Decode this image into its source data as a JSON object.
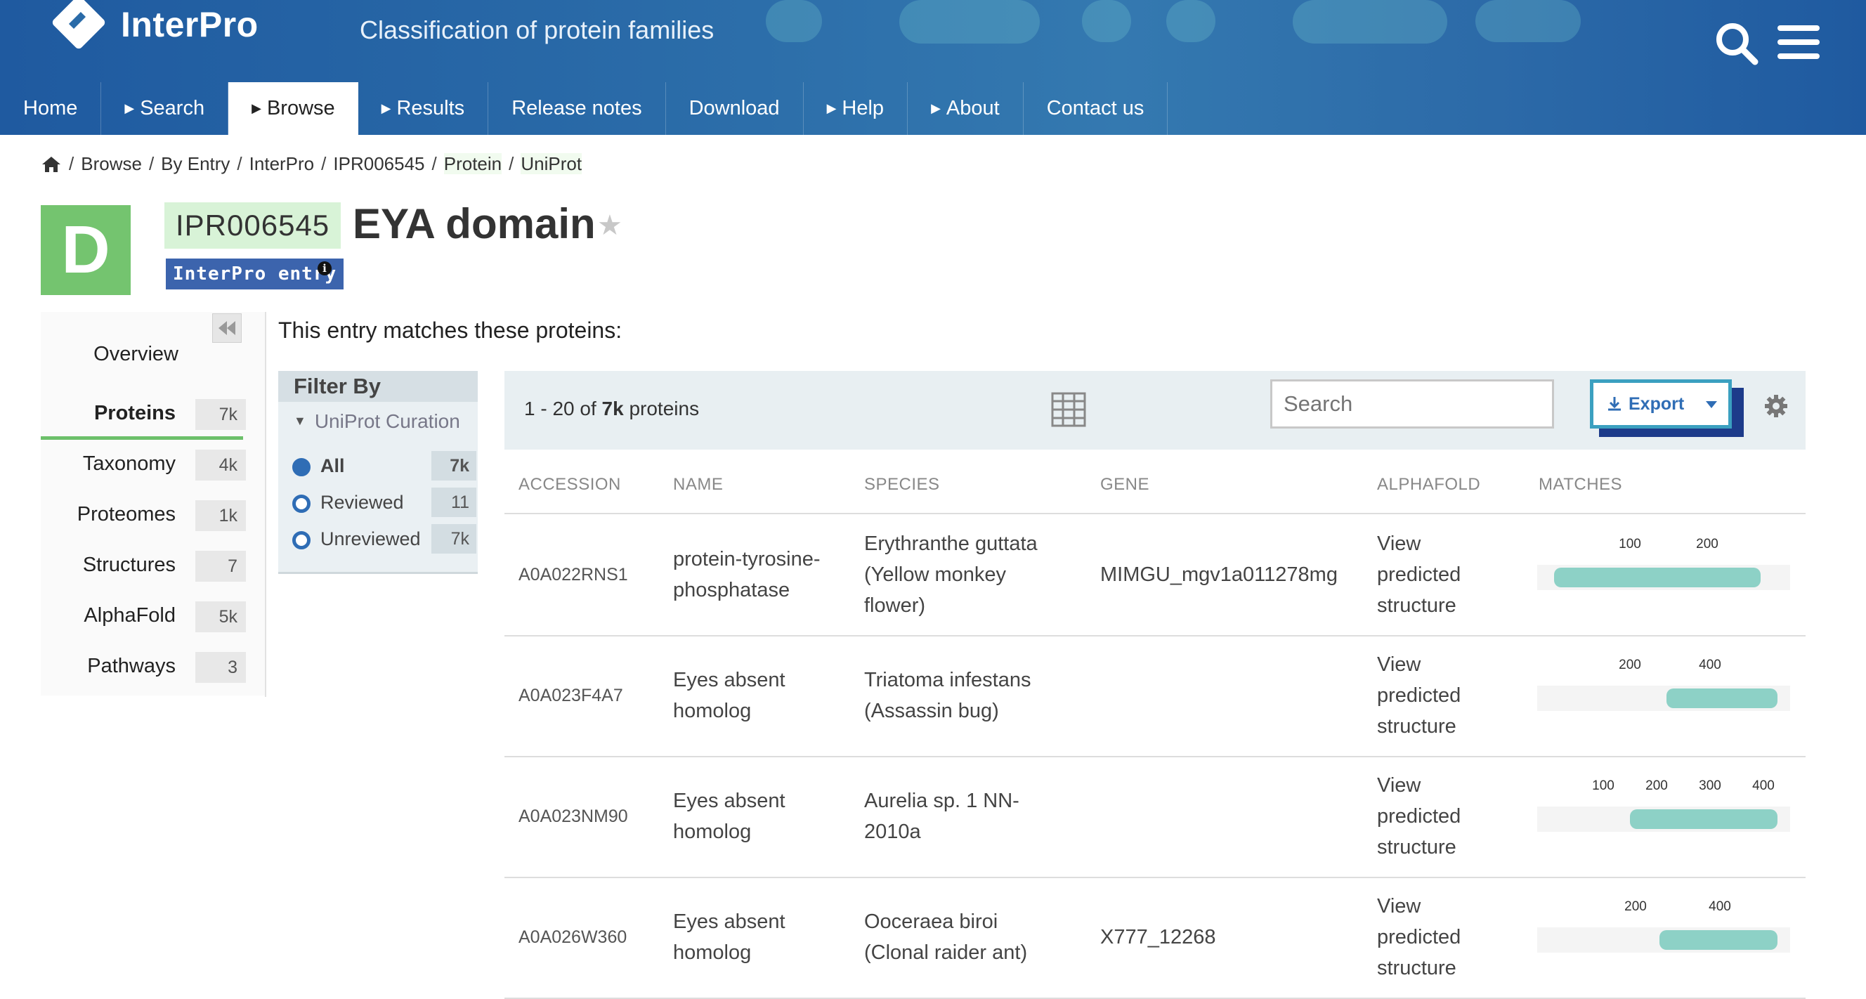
{
  "header": {
    "logo_text": "InterPro",
    "tagline": "Classification of protein families",
    "nav": [
      {
        "label": "Home",
        "caret": false,
        "active": false
      },
      {
        "label": "Search",
        "caret": true,
        "active": false
      },
      {
        "label": "Browse",
        "caret": true,
        "active": true
      },
      {
        "label": "Results",
        "caret": true,
        "active": false
      },
      {
        "label": "Release notes",
        "caret": false,
        "active": false
      },
      {
        "label": "Download",
        "caret": false,
        "active": false
      },
      {
        "label": "Help",
        "caret": true,
        "active": false
      },
      {
        "label": "About",
        "caret": true,
        "active": false
      },
      {
        "label": "Contact us",
        "caret": false,
        "active": false
      }
    ]
  },
  "breadcrumb": [
    "Browse",
    "By Entry",
    "InterPro",
    "IPR006545",
    "Protein",
    "UniProt"
  ],
  "entry": {
    "type_letter": "D",
    "accession": "IPR006545",
    "title": "EYA domain",
    "type_label": "InterPro entry"
  },
  "side_menu": [
    {
      "label": "Overview",
      "count": ""
    },
    {
      "label": "Proteins",
      "count": "7k",
      "active": true
    },
    {
      "label": "Taxonomy",
      "count": "4k"
    },
    {
      "label": "Proteomes",
      "count": "1k"
    },
    {
      "label": "Structures",
      "count": "7"
    },
    {
      "label": "AlphaFold",
      "count": "5k"
    },
    {
      "label": "Pathways",
      "count": "3"
    }
  ],
  "intro": "This entry matches these proteins:",
  "filter": {
    "title": "Filter By",
    "section": "UniProt Curation",
    "options": [
      {
        "label": "All",
        "count": "7k",
        "selected": true
      },
      {
        "label": "Reviewed",
        "count": "11",
        "selected": false
      },
      {
        "label": "Unreviewed",
        "count": "7k",
        "selected": false
      }
    ]
  },
  "toolbar": {
    "range": "1 - 20 of ",
    "total": "7k",
    "unit": " proteins",
    "search_placeholder": "Search",
    "export_label": "Export"
  },
  "table": {
    "columns": [
      "ACCESSION",
      "NAME",
      "SPECIES",
      "GENE",
      "ALPHAFOLD",
      "MATCHES"
    ],
    "rows": [
      {
        "accession": "A0A022RNS1",
        "name": [
          "protein-tyrosine-",
          "phosphatase"
        ],
        "species": [
          "Erythranthe guttata",
          "(Yellow monkey",
          "flower)"
        ],
        "gene": "MIMGU_mgv1a011278mg",
        "alphafold": [
          "View",
          "predicted",
          "structure"
        ],
        "ticks": [
          "100",
          "200"
        ]
      },
      {
        "accession": "A0A023F4A7",
        "name": [
          "Eyes absent",
          "homolog"
        ],
        "species": [
          "Triatoma infestans",
          "(Assassin bug)"
        ],
        "gene": "",
        "alphafold": [
          "View",
          "predicted",
          "structure"
        ],
        "ticks": [
          "200",
          "400"
        ]
      },
      {
        "accession": "A0A023NM90",
        "name": [
          "Eyes absent",
          "homolog"
        ],
        "species": [
          "Aurelia sp. 1 NN-",
          "2010a"
        ],
        "gene": "",
        "alphafold": [
          "View",
          "predicted",
          "structure"
        ],
        "ticks": [
          "100",
          "200",
          "300",
          "400"
        ]
      },
      {
        "accession": "A0A026W360",
        "name": [
          "Eyes absent",
          "homolog"
        ],
        "species": [
          "Ooceraea biroi",
          "(Clonal raider ant)"
        ],
        "gene": "X777_12268",
        "alphafold": [
          "View",
          "predicted",
          "structure"
        ],
        "ticks": [
          "200",
          "400"
        ]
      }
    ]
  },
  "colors": {
    "header": "#2a6ba8",
    "entry_badge": "#74c46f",
    "match_bar": "#8dd1c6",
    "accent": "#2f6db5"
  }
}
